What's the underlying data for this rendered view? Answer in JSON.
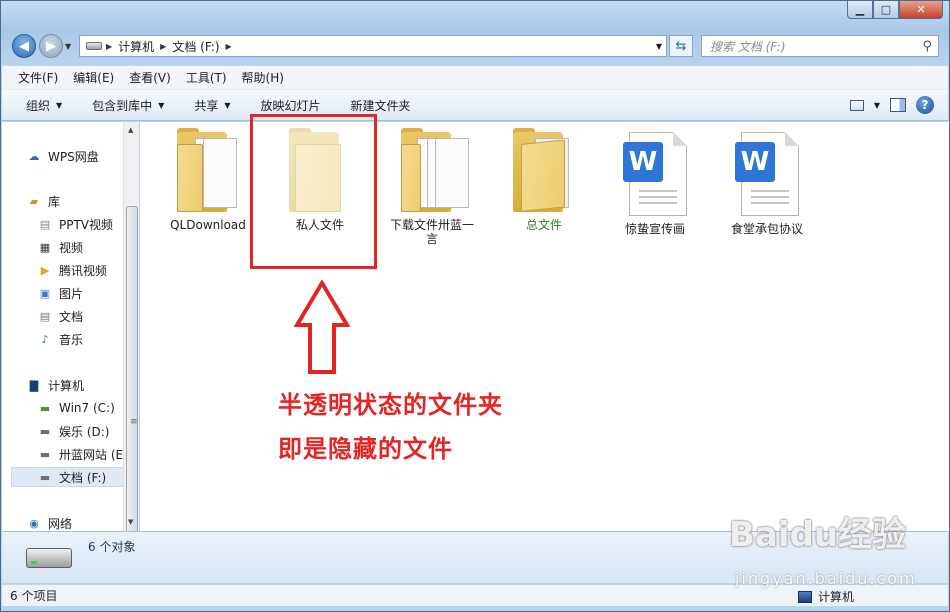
{
  "window": {
    "min_glyph": "▁",
    "max_glyph": "□",
    "close_glyph": "✕"
  },
  "address": {
    "segments": [
      "计算机",
      "文档 (F:)"
    ],
    "search_placeholder": "搜索 文档 (F:)"
  },
  "menu": [
    "文件(F)",
    "编辑(E)",
    "查看(V)",
    "工具(T)",
    "帮助(H)"
  ],
  "toolbar": {
    "organize": "组织",
    "include_in_library": "包含到库中",
    "share": "共享",
    "slideshow": "放映幻灯片",
    "new_folder": "新建文件夹"
  },
  "nav": {
    "wps": "WPS网盘",
    "library": "库",
    "pptv": "PPTV视频",
    "video": "视频",
    "tencent": "腾讯视频",
    "pictures": "图片",
    "documents": "文档",
    "music": "音乐",
    "computer": "计算机",
    "drive_c": "Win7 (C:)",
    "drive_d": "娱乐 (D:)",
    "drive_e": "卅蓝网站 (E",
    "drive_f": "文档 (F:)",
    "network": "网络"
  },
  "files": [
    {
      "name": "QLDownload",
      "type": "folder",
      "hidden": false
    },
    {
      "name": "私人文件",
      "type": "folder",
      "hidden": true
    },
    {
      "name": "下载文件卅蓝一言",
      "type": "folder",
      "hidden": false
    },
    {
      "name": "总文件",
      "type": "folder",
      "hidden": false,
      "color": "#2b7d22"
    },
    {
      "name": "惊蛰宣传画",
      "type": "wps-document",
      "hidden": false
    },
    {
      "name": "食堂承包协议",
      "type": "wps-document",
      "hidden": false
    }
  ],
  "file_label_line2": "言",
  "doc_letter": "W",
  "annotation": {
    "line1": "半透明状态的文件夹",
    "line2": "即是隐藏的文件",
    "color": "#e22626"
  },
  "details": {
    "count": "6 个对象"
  },
  "status": {
    "items": "6 个项目",
    "location": "计算机"
  },
  "watermark": {
    "brand": "Baidu经验",
    "url": "jingyan.baidu.com"
  }
}
